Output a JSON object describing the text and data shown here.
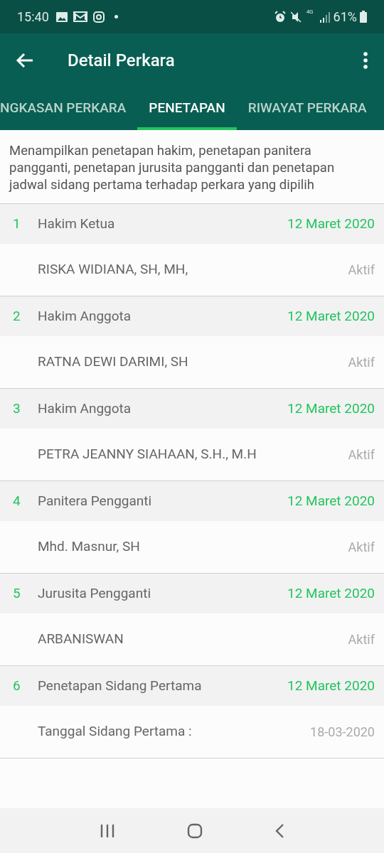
{
  "status_bar": {
    "time": "15:40",
    "network": "4G",
    "battery": "61%"
  },
  "app_bar": {
    "title": "Detail Perkara"
  },
  "tabs": [
    {
      "label": "NGKASAN PERKARA",
      "selected": false
    },
    {
      "label": "PENETAPAN",
      "selected": true
    },
    {
      "label": "RIWAYAT PERKARA",
      "selected": false
    }
  ],
  "description": "Menampilkan penetapan hakim, penetapan panitera pangganti, penetapan jurusita pangganti dan penetapan jadwal sidang pertama terhadap perkara yang dipilih",
  "sections": [
    {
      "number": "1",
      "title": "Hakim Ketua",
      "date": "12 Maret 2020",
      "name": "RISKA WIDIANA, SH, MH,",
      "status": "Aktif"
    },
    {
      "number": "2",
      "title": "Hakim Anggota",
      "date": "12 Maret 2020",
      "name": "RATNA DEWI DARIMI, SH",
      "status": "Aktif"
    },
    {
      "number": "3",
      "title": "Hakim Anggota",
      "date": "12 Maret 2020",
      "name": "PETRA JEANNY SIAHAAN, S.H., M.H",
      "status": "Aktif"
    },
    {
      "number": "4",
      "title": "Panitera Pengganti",
      "date": "12 Maret 2020",
      "name": "Mhd. Masnur, SH",
      "status": "Aktif"
    },
    {
      "number": "5",
      "title": "Jurusita Pengganti",
      "date": "12 Maret 2020",
      "name": "ARBANISWAN",
      "status": "Aktif"
    },
    {
      "number": "6",
      "title": "Penetapan Sidang Pertama",
      "date": "12 Maret 2020",
      "name": "Tanggal Sidang Pertama :",
      "status": "18-03-2020"
    }
  ]
}
